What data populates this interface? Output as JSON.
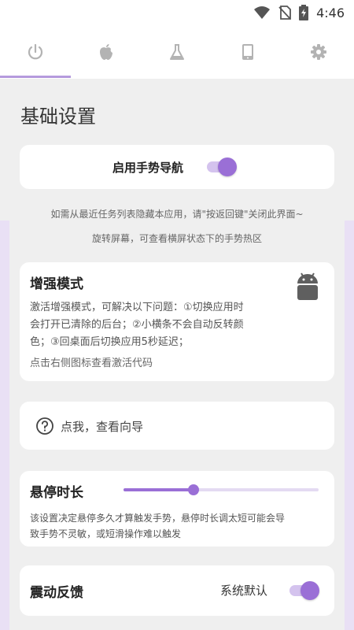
{
  "status": {
    "time": "4:46",
    "icons": [
      "wifi-icon",
      "no-sim-icon",
      "battery-charging-icon"
    ]
  },
  "tabs": [
    {
      "name": "power",
      "icon": "power-icon",
      "active": true
    },
    {
      "name": "apple",
      "icon": "apple-icon",
      "active": false
    },
    {
      "name": "lab",
      "icon": "flask-icon",
      "active": false
    },
    {
      "name": "device",
      "icon": "phone-icon",
      "active": false
    },
    {
      "name": "settings",
      "icon": "gear-icon",
      "active": false
    }
  ],
  "page": {
    "title": "基础设置"
  },
  "gesture": {
    "label": "启用手势导航",
    "enabled": true
  },
  "hint": {
    "line1": "如需从最近任务列表隐藏本应用，请\"按返回键\"关闭此界面~",
    "line2": "旋转屏幕，可查看横屏状态下的手势热区"
  },
  "enhanced": {
    "title": "增强模式",
    "desc_line1": "激活增强模式，可解决以下问题：①切换应用时",
    "desc_line2": "会打开已清除的后台；②小横条不会自动反转颜",
    "desc_line3": "色；③回桌面后切换应用5秒延迟；",
    "footnote": "点击右侧图标查看激活代码",
    "icon": "android-icon"
  },
  "guide": {
    "label": "点我，查看向导",
    "icon": "question-icon"
  },
  "hover": {
    "title": "悬停时长",
    "slider_level": 0.36,
    "desc_line1": "该设置决定悬停多久才算触发手势，悬停时长调太短可能会导",
    "desc_line2": "致手势不灵敏，或短滑操作难以触发"
  },
  "vibration": {
    "title": "震动反馈",
    "value": "系统默认",
    "enabled": true
  },
  "colors": {
    "accent": "#9a6fd6",
    "accent_light": "#d4c3ee",
    "indicator": "#b59add"
  }
}
